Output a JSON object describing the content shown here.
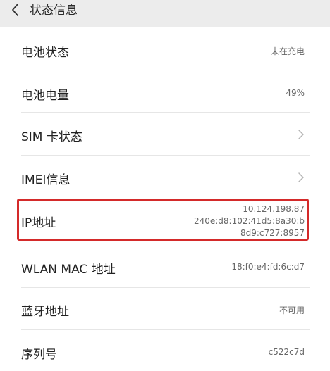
{
  "header": {
    "title": "状态信息"
  },
  "rows": [
    {
      "label": "电池状态",
      "value": "未在充电"
    },
    {
      "label": "电池电量",
      "value": "49%"
    },
    {
      "label": "SIM 卡状态",
      "value": ""
    },
    {
      "label": "IMEI信息",
      "value": ""
    },
    {
      "label": "IP地址",
      "value": ""
    },
    {
      "label": "WLAN MAC 地址",
      "value": "18:f0:e4:fd:6c:d7"
    },
    {
      "label": "蓝牙地址",
      "value": "不可用"
    },
    {
      "label": "序列号",
      "value": "c522c7d"
    }
  ],
  "ip": {
    "line1": "10.124.198.87",
    "line2": "240e:d8:102:41d5:8a30:b",
    "line3": "8d9:c727:8957"
  },
  "colors": {
    "highlight": "#d42a2a",
    "header_bg": "#ececec"
  }
}
